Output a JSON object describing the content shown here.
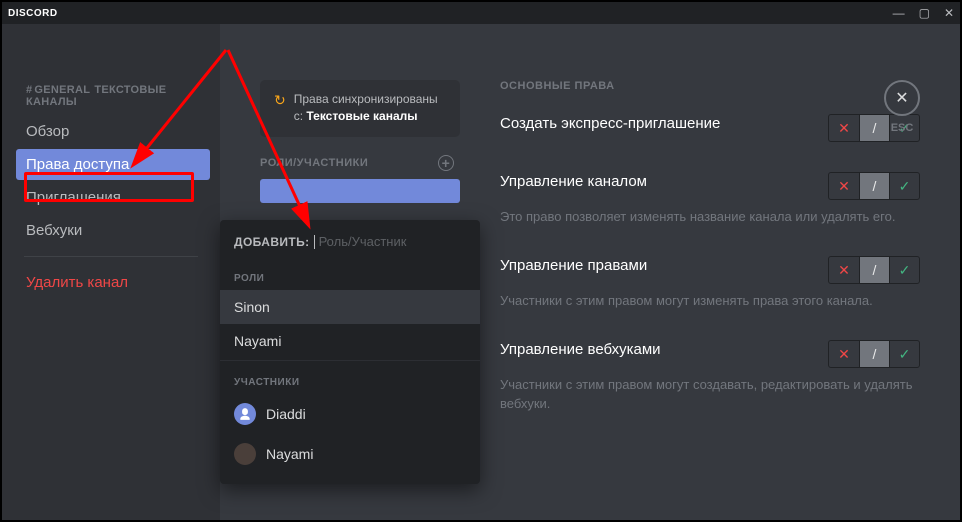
{
  "titlebar": {
    "brand": "DISCORD"
  },
  "sidebar": {
    "breadcrumb_hash": "#",
    "breadcrumb_channel": "GENERAL",
    "breadcrumb_category": "ТЕКСТОВЫЕ КАНАЛЫ",
    "items": [
      {
        "label": "Обзор"
      },
      {
        "label": "Права доступа"
      },
      {
        "label": "Приглашения"
      },
      {
        "label": "Вебхуки"
      }
    ],
    "delete_label": "Удалить канал"
  },
  "sync": {
    "line1": "Права синхронизированы",
    "line2_prefix": "с: ",
    "line2_bold": "Текстовые каналы"
  },
  "roles_header": "РОЛИ/УЧАСТНИКИ",
  "perms_header": "ОСНОВНЫЕ ПРАВА",
  "close_label": "ESC",
  "perms": [
    {
      "title": "Создать экспресс-приглашение",
      "desc": ""
    },
    {
      "title": "Управление каналом",
      "desc": "Это право позволяет изменять название канала или удалять его."
    },
    {
      "title": "Управление правами",
      "desc": "Участники с этим правом могут изменять права этого канала."
    },
    {
      "title": "Управление вебхуками",
      "desc": "Участники с этим правом могут создавать, редактировать и удалять вебхуки."
    }
  ],
  "popup": {
    "add_label": "ДОБАВИТЬ:",
    "placeholder": "Роль/Участник",
    "roles_header": "РОЛИ",
    "members_header": "УЧАСТНИКИ",
    "roles": [
      {
        "name": "Sinon"
      },
      {
        "name": "Nayami"
      }
    ],
    "members": [
      {
        "name": "Diaddi"
      },
      {
        "name": "Nayami"
      }
    ]
  }
}
